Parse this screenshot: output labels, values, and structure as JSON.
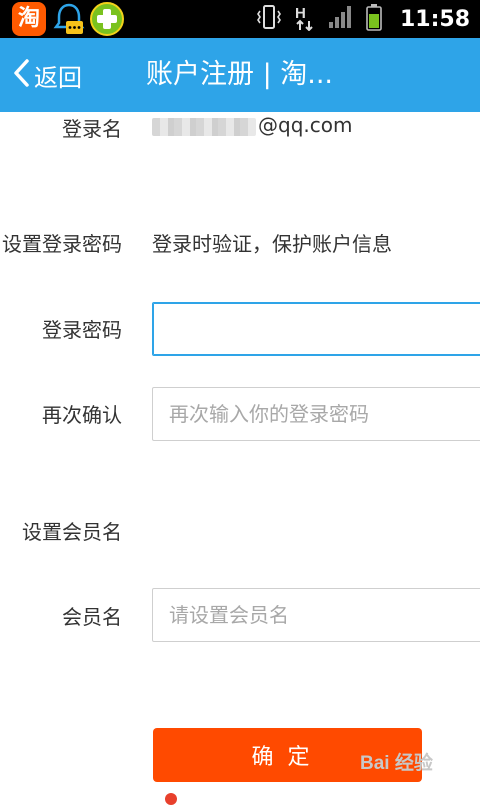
{
  "status_bar": {
    "app_icon_taobao": "淘",
    "time": "11:58",
    "network_type": "H"
  },
  "header": {
    "back_label": "返回",
    "title": "账户注册 | 淘..."
  },
  "form": {
    "login_name_label": "登录名",
    "login_name_value_suffix": "@qq.com",
    "set_password_section_label": "设置登录密码",
    "set_password_hint": "登录时验证，保护账户信息",
    "password_label": "登录密码",
    "password_value": "",
    "confirm_label": "再次确认",
    "confirm_placeholder": "再次输入你的登录密码",
    "set_member_section_label": "设置会员名",
    "member_label": "会员名",
    "member_placeholder": "请设置会员名"
  },
  "confirm_button_label": "确定",
  "watermark": "Bai 经验",
  "colors": {
    "title_bar": "#2ea4e8",
    "confirm_button": "#ff4a00",
    "input_focus_border": "#2ea4e8"
  }
}
